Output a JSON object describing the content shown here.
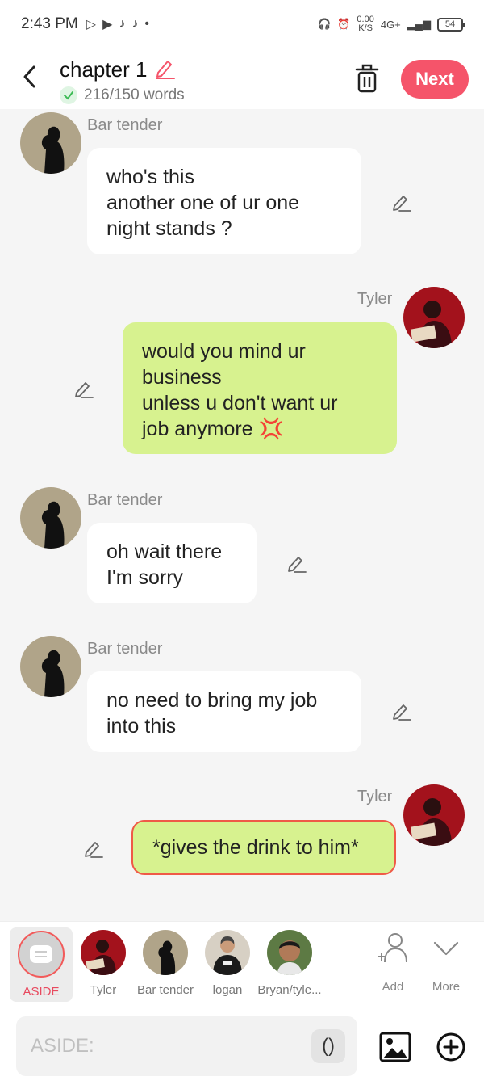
{
  "status_bar": {
    "time": "2:43 PM",
    "network_speed_value": "0.00",
    "network_speed_unit": "K/S",
    "network_type": "4G+",
    "battery": "54"
  },
  "header": {
    "title": "chapter 1",
    "word_count": "216/150 words",
    "next_label": "Next"
  },
  "messages": [
    {
      "speaker": "Bar tender",
      "side": "left",
      "lines": [
        "who's this",
        "another one of ur one",
        "night stands ?"
      ]
    },
    {
      "speaker": "Tyler",
      "side": "right",
      "lines": [
        "would you mind ur",
        "business",
        "unless u don't want ur",
        "job anymore 💢"
      ]
    },
    {
      "speaker": "Bar tender",
      "side": "left",
      "lines": [
        "oh wait there",
        "I'm sorry"
      ]
    },
    {
      "speaker": "Bar tender",
      "side": "left",
      "lines": [
        "no need to bring my job",
        "into this"
      ]
    },
    {
      "speaker": "Tyler",
      "side": "right",
      "lines": [
        "*gives the drink to him*"
      ]
    }
  ],
  "characters": [
    {
      "label": "ASIDE",
      "selected": true
    },
    {
      "label": "Tyler"
    },
    {
      "label": "Bar tender"
    },
    {
      "label": "logan"
    },
    {
      "label": "Bryan/tyle..."
    }
  ],
  "actions": {
    "add_label": "Add",
    "more_label": "More"
  },
  "input": {
    "placeholder": "ASIDE:",
    "paren_label": "()"
  },
  "colors": {
    "accent": "#f5546a",
    "green_bubble": "#d7f28f",
    "outline": "#ef5a47",
    "aside_label": "#e84a5f"
  }
}
